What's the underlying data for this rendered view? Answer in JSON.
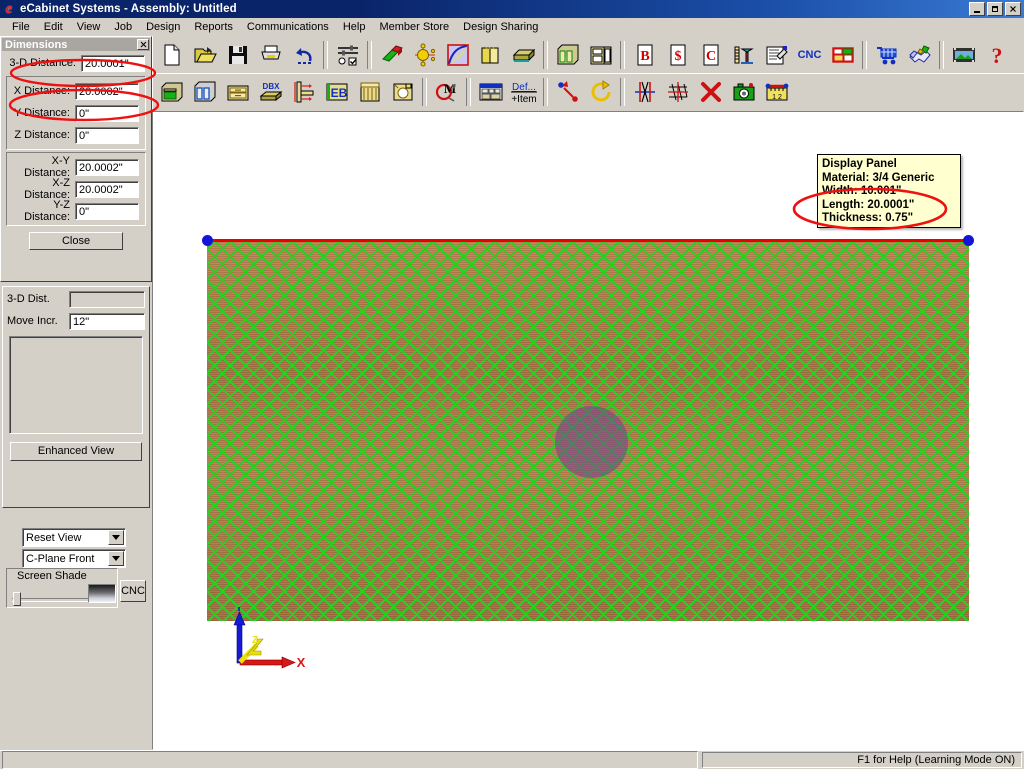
{
  "window": {
    "title": "eCabinet Systems - Assembly: Untitled",
    "app_icon": "ecabinet-logo-icon",
    "minimize": "minimize-icon",
    "maximize": "restore-icon",
    "close": "close-icon"
  },
  "menubar": {
    "items": [
      {
        "label": "File"
      },
      {
        "label": "Edit"
      },
      {
        "label": "View"
      },
      {
        "label": "Job"
      },
      {
        "label": "Design"
      },
      {
        "label": "Reports"
      },
      {
        "label": "Communications"
      },
      {
        "label": "Help"
      },
      {
        "label": "Member Store"
      },
      {
        "label": "Design Sharing"
      }
    ]
  },
  "toolbar_row1": [
    {
      "name": "new-document-icon",
      "type": "icon"
    },
    {
      "name": "open-folder-icon",
      "type": "icon"
    },
    {
      "name": "save-disk-icon",
      "type": "icon"
    },
    {
      "name": "print-icon",
      "type": "icon"
    },
    {
      "name": "undo-icon",
      "type": "icon"
    },
    {
      "name": "separator",
      "type": "sep"
    },
    {
      "name": "settings-sliders-icon",
      "type": "icon"
    },
    {
      "name": "separator",
      "type": "sep"
    },
    {
      "name": "extrusion-icon",
      "type": "icon"
    },
    {
      "name": "node-points-icon",
      "type": "icon"
    },
    {
      "name": "curve-surface-icon",
      "type": "icon"
    },
    {
      "name": "book-pages-icon",
      "type": "icon"
    },
    {
      "name": "panel-board-icon",
      "type": "icon"
    },
    {
      "name": "separator",
      "type": "sep"
    },
    {
      "name": "cabinet-box-icon",
      "type": "icon"
    },
    {
      "name": "cabinet-library-icon",
      "type": "icon"
    },
    {
      "name": "shelf-stack-icon",
      "type": "icon"
    },
    {
      "name": "countertop-icon",
      "type": "icon"
    },
    {
      "name": "separator",
      "type": "sep"
    },
    {
      "name": "bid-report-icon",
      "type": "text",
      "text": "B"
    },
    {
      "name": "cost-report-icon",
      "type": "text",
      "text": "$"
    },
    {
      "name": "customer-report-icon",
      "type": "text",
      "text": "C"
    },
    {
      "name": "measure-tool-icon",
      "type": "icon"
    },
    {
      "name": "edit-notes-icon",
      "type": "icon"
    },
    {
      "name": "cnc-toolbar-icon",
      "type": "text",
      "text": "CNC"
    },
    {
      "name": "nesting-sheet-icon",
      "type": "icon"
    },
    {
      "name": "separator",
      "type": "sep"
    },
    {
      "name": "shopping-cart-icon",
      "type": "icon"
    },
    {
      "name": "handshake-icon",
      "type": "icon"
    },
    {
      "name": "separator",
      "type": "sep"
    },
    {
      "name": "render-image-icon",
      "type": "icon"
    },
    {
      "name": "help-question-icon",
      "type": "text",
      "text": "?"
    }
  ],
  "toolbar_row2": [
    {
      "name": "base-cabinet-icon",
      "type": "icon"
    },
    {
      "name": "wall-cabinet-icon",
      "type": "icon"
    },
    {
      "name": "drawer-unit-icon",
      "type": "icon"
    },
    {
      "name": "dbx-panel-icon",
      "type": "text",
      "text": "DBX"
    },
    {
      "name": "dimension-part-icon",
      "type": "icon"
    },
    {
      "name": "edgeband-icon",
      "type": "text",
      "text": "EB"
    },
    {
      "name": "door-front-icon",
      "type": "icon"
    },
    {
      "name": "hardware-icon",
      "type": "icon"
    },
    {
      "name": "separator",
      "type": "sep"
    },
    {
      "name": "member-store-icon",
      "type": "text",
      "text": "M"
    },
    {
      "name": "separator",
      "type": "sep"
    },
    {
      "name": "catalog-browser-icon",
      "type": "icon"
    },
    {
      "name": "define-item-icon",
      "type": "text",
      "text": "Def...",
      "text2": "+Item"
    },
    {
      "name": "separator",
      "type": "sep"
    },
    {
      "name": "point-to-point-icon",
      "type": "icon"
    },
    {
      "name": "rotate-icon",
      "type": "icon"
    },
    {
      "name": "separator",
      "type": "sep"
    },
    {
      "name": "align-centers-icon",
      "type": "icon"
    },
    {
      "name": "grid-snap-icon",
      "type": "icon"
    },
    {
      "name": "delete-x-icon",
      "type": "text",
      "text": "X"
    },
    {
      "name": "camera-icon",
      "type": "icon"
    },
    {
      "name": "ruler-measure-icon",
      "type": "icon"
    }
  ],
  "dimensions_panel": {
    "title": "Dimensions",
    "close_icon": "panel-close-icon",
    "primary": {
      "label": "3-D Distance:",
      "value": "20.0001\""
    },
    "axis_fields": [
      {
        "label": "X Distance:",
        "value": "20.0002\""
      },
      {
        "label": "Y Distance:",
        "value": "0\""
      },
      {
        "label": "Z Distance:",
        "value": "0\""
      }
    ],
    "plane_fields": [
      {
        "label": "X-Y Distance:",
        "value": "20.0002\""
      },
      {
        "label": "X-Z Distance:",
        "value": "20.0002\""
      },
      {
        "label": "Y-Z Distance:",
        "value": "0\""
      }
    ],
    "close_button": "Close"
  },
  "distance_panel": {
    "dist_label": "3-D Dist.",
    "dist_value": "",
    "move_label": "Move Incr.",
    "move_value": "12\"",
    "enhanced_view_button": "Enhanced View"
  },
  "view_panel": {
    "reset_view": "Reset View",
    "cplane": "C-Plane Front",
    "screen_shade_label": "Screen Shade",
    "cnc_button": "CNC",
    "dropdown_icon": "chevron-down-icon",
    "slider_icon": "slider-thumb"
  },
  "viewport": {
    "tooltip": {
      "lines": [
        "Display Panel",
        "Material: 3/4 Generic",
        "Width: 10.001\"",
        "Length: 20.0001\"",
        "Thickness: 0.75\""
      ]
    },
    "axis_gizmo": {
      "x": "X",
      "y": "Y",
      "z": "Z"
    },
    "colors": {
      "panel_face": "#b07848",
      "hatch": "#22d422",
      "selected_edge": "#ee0000",
      "endpoint": "#1414d8",
      "hole": "#783c96",
      "annotation": "#ee1111"
    }
  },
  "statusbar": {
    "left": "",
    "right": "F1 for Help (Learning Mode ON)"
  }
}
